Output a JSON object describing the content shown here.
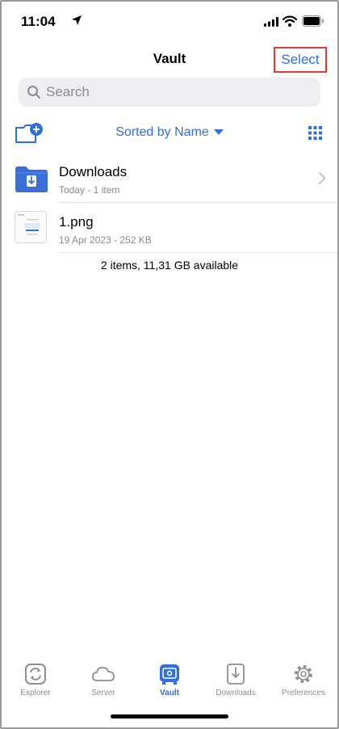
{
  "status": {
    "time": "11:04"
  },
  "nav": {
    "title": "Vault",
    "select_label": "Select"
  },
  "search": {
    "placeholder": "Search"
  },
  "toolbar": {
    "sort_label": "Sorted by Name"
  },
  "items": [
    {
      "name": "Downloads",
      "subtitle": "Today - 1 item",
      "icon": "folder-download-icon"
    },
    {
      "name": "1.png",
      "subtitle": "19 Apr 2023 - 252 KB",
      "icon": "image-thumbnail"
    }
  ],
  "footer": {
    "summary": "2 items, 11,31 GB available"
  },
  "tabs": [
    {
      "label": "Explorer",
      "icon": "explorer-icon"
    },
    {
      "label": "Server",
      "icon": "cloud-icon"
    },
    {
      "label": "Vault",
      "icon": "vault-icon",
      "active": true
    },
    {
      "label": "Downloads",
      "icon": "download-icon"
    },
    {
      "label": "Preferences",
      "icon": "gear-icon"
    }
  ],
  "colors": {
    "accent": "#2f6fe0",
    "highlight": "#e53935",
    "folder": "#3b6fd6"
  }
}
